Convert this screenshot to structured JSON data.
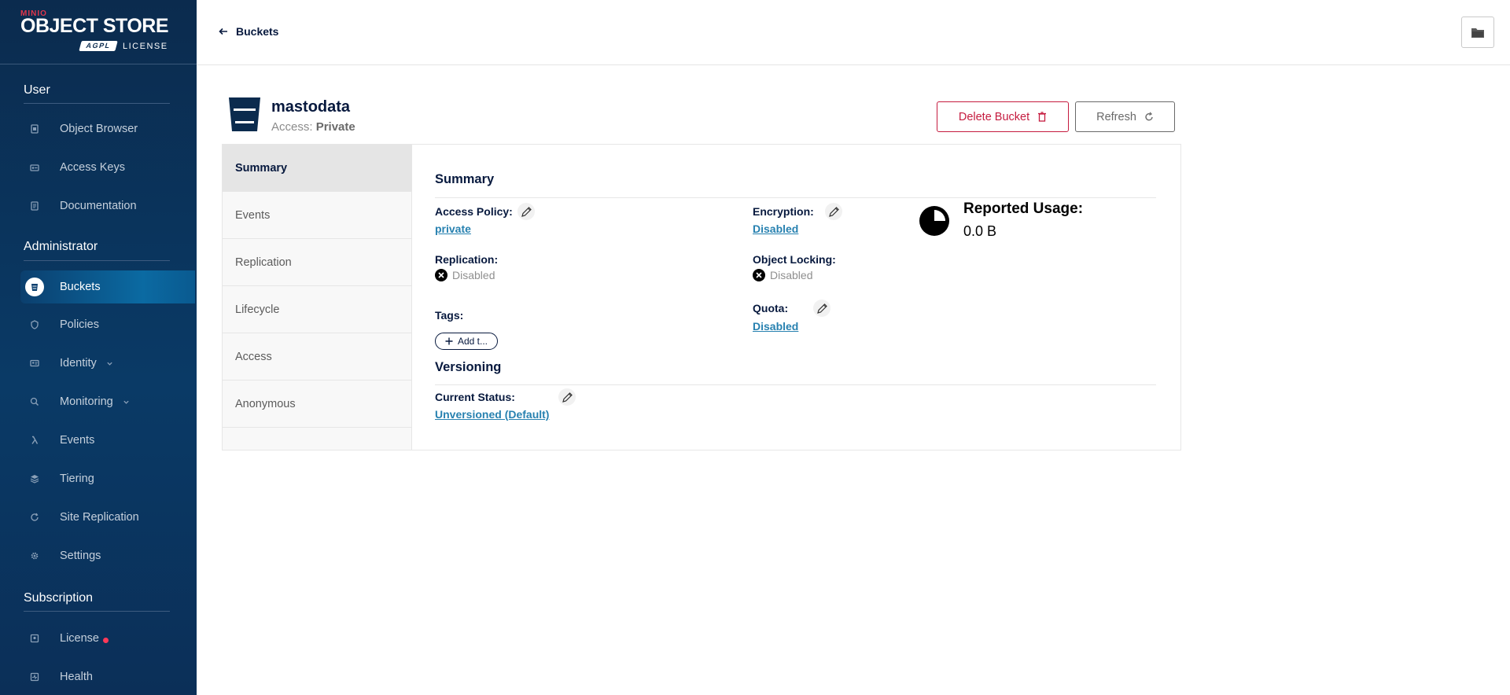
{
  "logo": {
    "brand": "MINIO",
    "product": "OBJECT STORE",
    "badge": "AGPL",
    "license": "LICENSE"
  },
  "sidebar": {
    "sections": [
      {
        "title": "User",
        "items": [
          {
            "label": "Object Browser",
            "icon": "object-browser-icon"
          },
          {
            "label": "Access Keys",
            "icon": "access-keys-icon"
          },
          {
            "label": "Documentation",
            "icon": "documentation-icon"
          }
        ]
      },
      {
        "title": "Administrator",
        "items": [
          {
            "label": "Buckets",
            "icon": "buckets-icon",
            "active": true
          },
          {
            "label": "Policies",
            "icon": "policies-icon"
          },
          {
            "label": "Identity",
            "icon": "identity-icon",
            "expandable": true
          },
          {
            "label": "Monitoring",
            "icon": "monitoring-icon",
            "expandable": true
          },
          {
            "label": "Events",
            "icon": "lambda-icon"
          },
          {
            "label": "Tiering",
            "icon": "tiering-icon"
          },
          {
            "label": "Site Replication",
            "icon": "site-replication-icon"
          },
          {
            "label": "Settings",
            "icon": "settings-icon"
          }
        ]
      },
      {
        "title": "Subscription",
        "items": [
          {
            "label": "License",
            "icon": "license-icon",
            "alert": true
          },
          {
            "label": "Health",
            "icon": "health-icon"
          }
        ]
      }
    ]
  },
  "topbar": {
    "back_label": "Buckets"
  },
  "bucket": {
    "name": "mastodata",
    "access_label": "Access:",
    "access_value": "Private",
    "delete_label": "Delete Bucket",
    "refresh_label": "Refresh"
  },
  "tabs": [
    "Summary",
    "Events",
    "Replication",
    "Lifecycle",
    "Access",
    "Anonymous"
  ],
  "summary": {
    "title": "Summary",
    "access_policy_label": "Access Policy:",
    "access_policy_value": "private",
    "encryption_label": "Encryption:",
    "encryption_value": "Disabled",
    "replication_label": "Replication:",
    "replication_value": "Disabled",
    "object_locking_label": "Object Locking:",
    "object_locking_value": "Disabled",
    "tags_label": "Tags:",
    "add_tag_label": "Add t...",
    "quota_label": "Quota:",
    "quota_value": "Disabled",
    "reported_usage_label": "Reported Usage:",
    "reported_usage_value": "0.0 B"
  },
  "versioning": {
    "title": "Versioning",
    "current_status_label": "Current Status:",
    "current_status_value": "Unversioned (Default)"
  },
  "colors": {
    "sidebar_bg": "#0b2b4e",
    "active_item": "#0b6aa2",
    "danger": "#c51b3f",
    "link": "#2781b0"
  }
}
